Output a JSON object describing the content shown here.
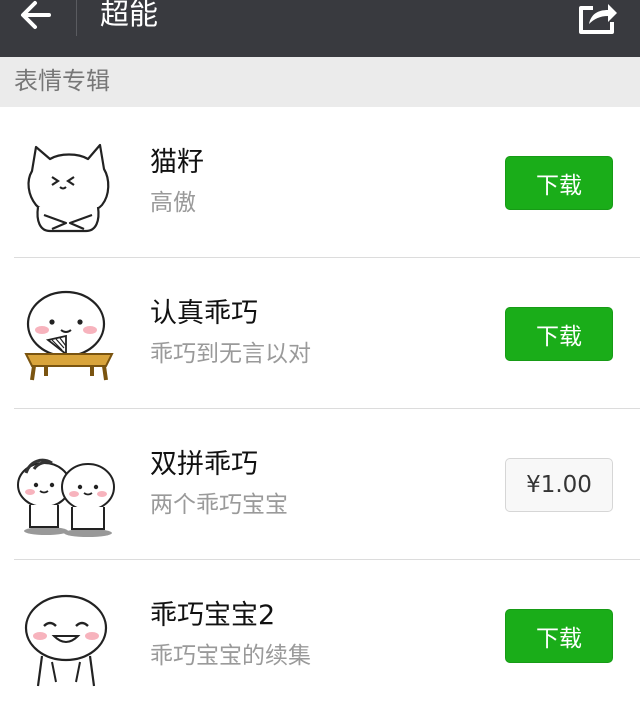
{
  "header": {
    "title": "超能",
    "back_icon": "arrow-left-icon",
    "share_icon": "share-icon",
    "bg_color": "#393a3f"
  },
  "section": {
    "title": "表情专辑"
  },
  "items": [
    {
      "name": "猫籽",
      "desc": "高傲",
      "action": "下载",
      "action_type": "download",
      "icon": "cat-sticker-icon"
    },
    {
      "name": "认真乖巧",
      "desc": "乖巧到无言以对",
      "action": "下载",
      "action_type": "download",
      "icon": "fan-sticker-icon"
    },
    {
      "name": "双拼乖巧",
      "desc": "两个乖巧宝宝",
      "action": "¥1.00",
      "action_type": "price",
      "icon": "twins-sticker-icon"
    },
    {
      "name": "乖巧宝宝2",
      "desc": "乖巧宝宝的续集",
      "action": "下载",
      "action_type": "download",
      "icon": "baby-sticker-icon"
    }
  ],
  "colors": {
    "download_green": "#1aad19"
  }
}
